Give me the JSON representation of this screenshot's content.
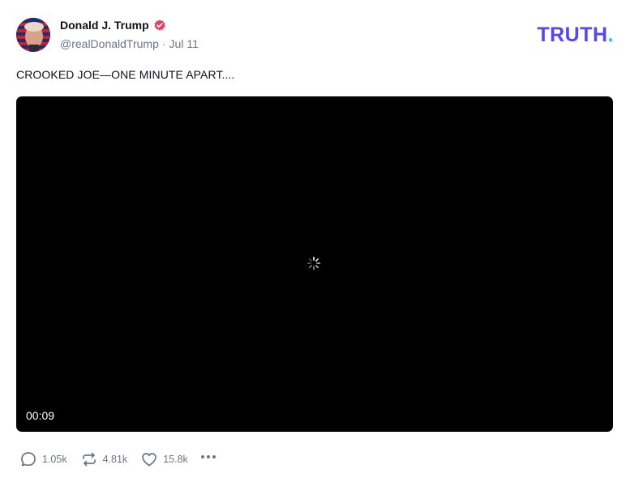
{
  "post": {
    "display_name": "Donald J. Trump",
    "handle": "@realDonaldTrump",
    "separator": "·",
    "date": "Jul 11",
    "text": "CROOKED JOE—ONE MINUTE APART...."
  },
  "brand": {
    "logo_text": "TRUTH",
    "logo_dot": ".",
    "colors": {
      "logo": "#5448ee",
      "dot": "#0bd9a6",
      "verified": "#e2445c"
    }
  },
  "video": {
    "timestamp": "00:09",
    "state_icon": "loading-spinner-icon"
  },
  "actions": {
    "replies": "1.05k",
    "retruths": "4.81k",
    "likes": "15.8k"
  },
  "icons": {
    "reply": "speech-bubble-icon",
    "retruth": "retruth-arrows-icon",
    "like": "heart-icon",
    "more": "ellipsis-icon",
    "verified": "verified-badge-icon"
  }
}
